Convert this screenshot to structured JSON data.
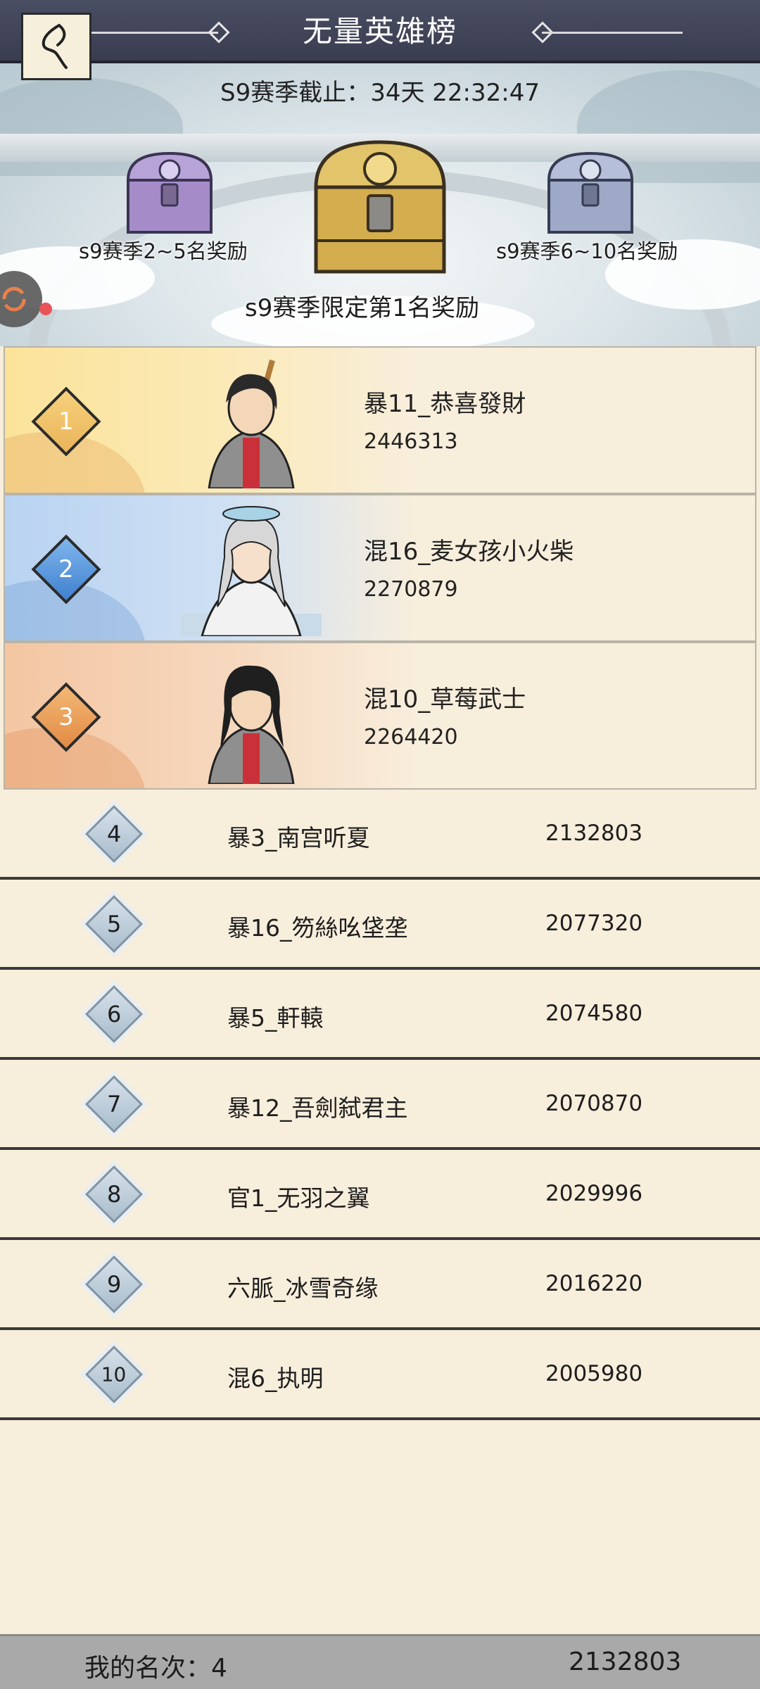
{
  "header": {
    "title": "无量英雄榜",
    "back_icon": "back-arrow-icon"
  },
  "season": {
    "countdown": "S9赛季截止：34天 22:32:47",
    "rewards": {
      "left": "s9赛季2~5名奖励",
      "center": "s9赛季限定第1名奖励",
      "right": "s9赛季6~10名奖励"
    }
  },
  "top3": [
    {
      "rank": "1",
      "name": "暴11_恭喜發財",
      "score": "2446313"
    },
    {
      "rank": "2",
      "name": "混16_麦女孩小火柴",
      "score": "2270879"
    },
    {
      "rank": "3",
      "name": "混10_草莓武士",
      "score": "2264420"
    }
  ],
  "ranking": [
    {
      "rank": "4",
      "name": "暴3_南宫听夏",
      "score": "2132803"
    },
    {
      "rank": "5",
      "name": "暴16_笏絲吆垡垄",
      "score": "2077320"
    },
    {
      "rank": "6",
      "name": "暴5_軒轅",
      "score": "2074580"
    },
    {
      "rank": "7",
      "name": "暴12_吾劍弑君主",
      "score": "2070870"
    },
    {
      "rank": "8",
      "name": "官1_无羽之翼",
      "score": "2029996"
    },
    {
      "rank": "9",
      "name": "六脈_冰雪奇缘",
      "score": "2016220"
    },
    {
      "rank": "10",
      "name": "混6_执明",
      "score": "2005980"
    }
  ],
  "my_rank": {
    "label": "我的名次：4",
    "score": "2132803"
  },
  "colors": {
    "header_bg": "#3f4256",
    "rank1": "#f2c56b",
    "rank2": "#5b9fe0",
    "rank3": "#eaa25e",
    "list_bg": "#f8eedc"
  }
}
